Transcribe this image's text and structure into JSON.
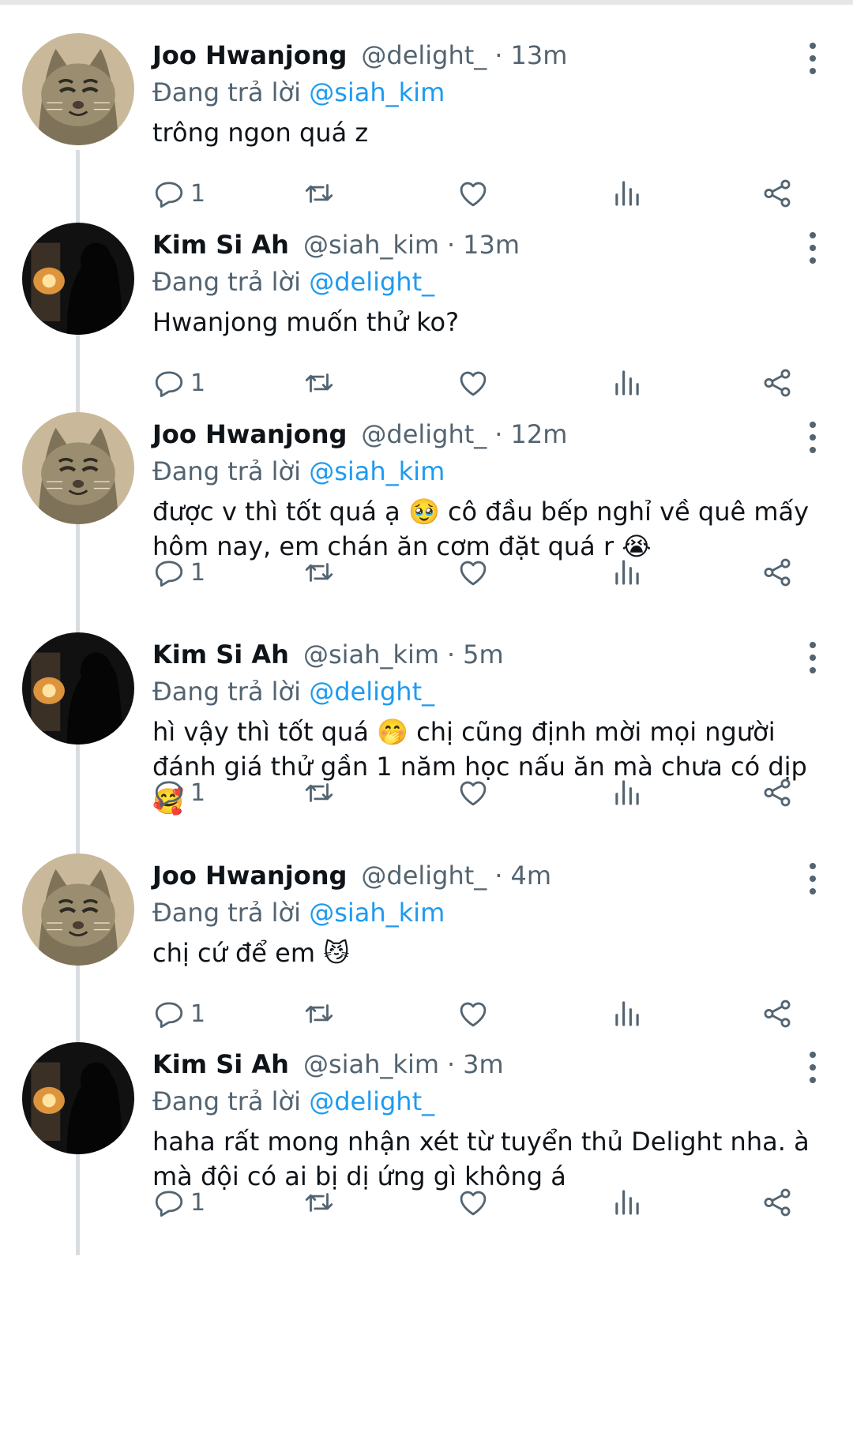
{
  "reply_prefix": "Đang trả lời",
  "colors": {
    "accent": "#1d9bf0",
    "secondary_text": "#536471",
    "primary_text": "#0f1419"
  },
  "tweets": [
    {
      "name": "Joo Hwanjong",
      "handle": "@delight_",
      "dot": "·",
      "time": "13m",
      "reply_to": "@siah_kim",
      "avatar": "cat-avatar",
      "text": "trông ngon quá z",
      "reply_count": "1"
    },
    {
      "name": "Kim Si Ah",
      "handle": "@siah_kim",
      "dot": "·",
      "time": "13m",
      "reply_to": "@delight_",
      "avatar": "silhouette-avatar",
      "text": "Hwanjong muốn thử ko?",
      "reply_count": "1"
    },
    {
      "name": "Joo Hwanjong",
      "handle": "@delight_",
      "dot": "·",
      "time": "12m",
      "reply_to": "@siah_kim",
      "avatar": "cat-avatar",
      "text": "được v thì tốt quá ạ 🥹 cô đầu bếp nghỉ về quê mấy hôm nay, em chán ăn cơm đặt quá r 😭",
      "reply_count": "1"
    },
    {
      "name": "Kim Si Ah",
      "handle": "@siah_kim",
      "dot": "·",
      "time": "5m",
      "reply_to": "@delight_",
      "avatar": "silhouette-avatar",
      "text": "hì vậy thì tốt quá 🤭 chị cũng định mời mọi người đánh giá thử gần 1 năm học nấu ăn mà chưa có dịp 🥰",
      "reply_count": "1"
    },
    {
      "name": "Joo Hwanjong",
      "handle": "@delight_",
      "dot": "·",
      "time": "4m",
      "reply_to": "@siah_kim",
      "avatar": "cat-avatar",
      "text": "chị cứ để em 😼",
      "reply_count": "1"
    },
    {
      "name": "Kim Si Ah",
      "handle": "@siah_kim",
      "dot": "·",
      "time": "3m",
      "reply_to": "@delight_",
      "avatar": "silhouette-avatar",
      "text": "haha rất mong nhận xét từ tuyển thủ Delight nha. à mà đội có ai bị dị ứng gì không á",
      "reply_count": "1"
    }
  ]
}
